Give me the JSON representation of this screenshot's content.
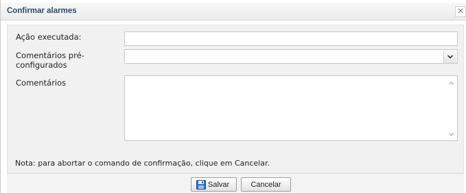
{
  "dialog": {
    "title": "Confirmar alarmes",
    "close_glyph": "✕"
  },
  "form": {
    "action_label": "Ação executada:",
    "action_value": "",
    "preset_label_line1": "Comentários pré-",
    "preset_label_line2": "configurados",
    "preset_value": "",
    "comments_label": "Comentários",
    "comments_value": ""
  },
  "note": "Nota: para abortar o comando de confirmação, clique em Cancelar.",
  "buttons": {
    "save_label": "Salvar",
    "save_icon": "floppy-disk-icon",
    "cancel_label": "Cancelar"
  }
}
